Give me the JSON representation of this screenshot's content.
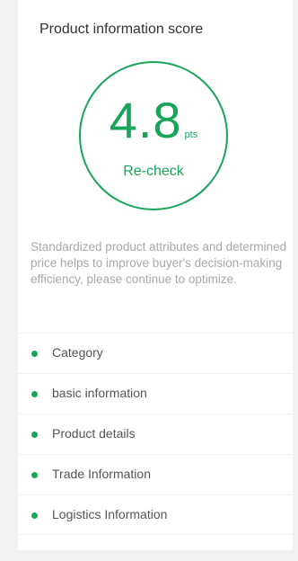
{
  "panel": {
    "title": "Product information score"
  },
  "score": {
    "value": "4.8",
    "unit": "pts",
    "recheck_label": "Re-check"
  },
  "description": "Standardized product attributes and determined price helps to improve buyer's decision-making efficiency, please continue to optimize.",
  "checklist": [
    {
      "label": "Category",
      "status": "complete"
    },
    {
      "label": "basic information",
      "status": "complete"
    },
    {
      "label": "Product details",
      "status": "complete"
    },
    {
      "label": "Trade Information",
      "status": "complete"
    },
    {
      "label": "Logistics Information",
      "status": "complete"
    }
  ],
  "colors": {
    "accent": "#17a659",
    "background": "#f2f2f2",
    "panel": "#ffffff",
    "muted_text": "#a8a8a8"
  }
}
